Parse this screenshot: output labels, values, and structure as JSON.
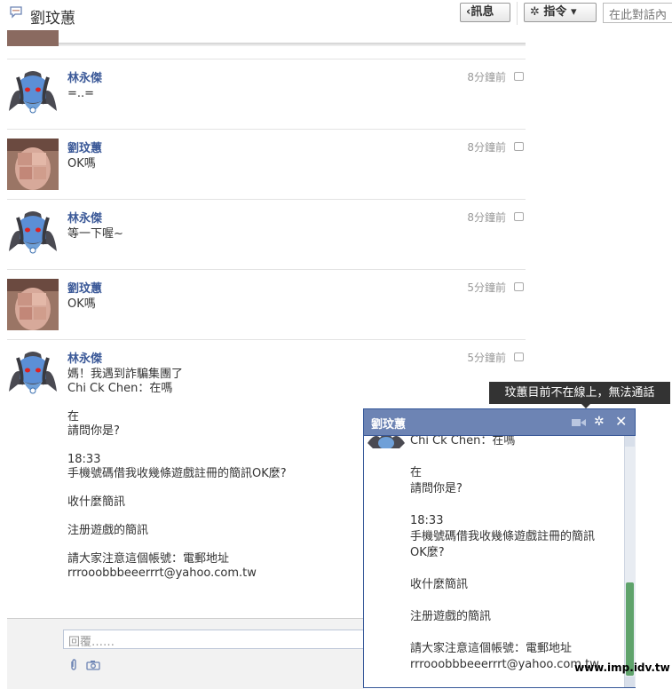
{
  "header": {
    "title": "劉玟蕙",
    "messages_button": "‹訊息",
    "actions_button": "✲ 指令 ▾",
    "search_placeholder": "在此對話內"
  },
  "messages": [
    {
      "sender": "林永傑",
      "time": "8分鐘前",
      "text": "=..=",
      "avatar": "demon-avatar"
    },
    {
      "sender": "劉玟蕙",
      "time": "8分鐘前",
      "text": "OK嗎",
      "avatar": "blurred-photo-avatar"
    },
    {
      "sender": "林永傑",
      "time": "8分鐘前",
      "text": "等一下喔~",
      "avatar": "demon-avatar"
    },
    {
      "sender": "劉玟蕙",
      "time": "5分鐘前",
      "text": "OK嗎",
      "avatar": "blurred-photo-avatar"
    },
    {
      "sender": "林永傑",
      "time": "5分鐘前",
      "text": "媽！我遇到詐騙集團了\nChi Ck Chen：在嗎\n\n在\n請問你是?\n\n18:33\n手機號碼借我收幾條遊戲註冊的簡訊OK麼?\n\n收什麼簡訊\n\n注册遊戲的簡訊\n\n請大家注意這個帳號：電郵地址\nrrrooobbbeeerrrt@yahoo.com.tw",
      "avatar": "demon-avatar"
    }
  ],
  "composer": {
    "reply_placeholder": "回覆……"
  },
  "tooltip": {
    "text": "玟蕙目前不在線上，無法通話"
  },
  "chat_window": {
    "title": "劉玟蕙",
    "text": "Chi Ck Chen：在嗎\n\n在\n請問你是?\n\n18:33\n手機號碼借我收幾條遊戲註冊的簡訊\nOK麼?\n\n收什麼簡訊\n\n注册遊戲的簡訊\n\n請大家注意這個帳號：電郵地址\nrrrooobbbeeerrrt@yahoo.com.tw",
    "gear": "✲",
    "close": "✕"
  },
  "watermark": "www.imp.idv.tw"
}
